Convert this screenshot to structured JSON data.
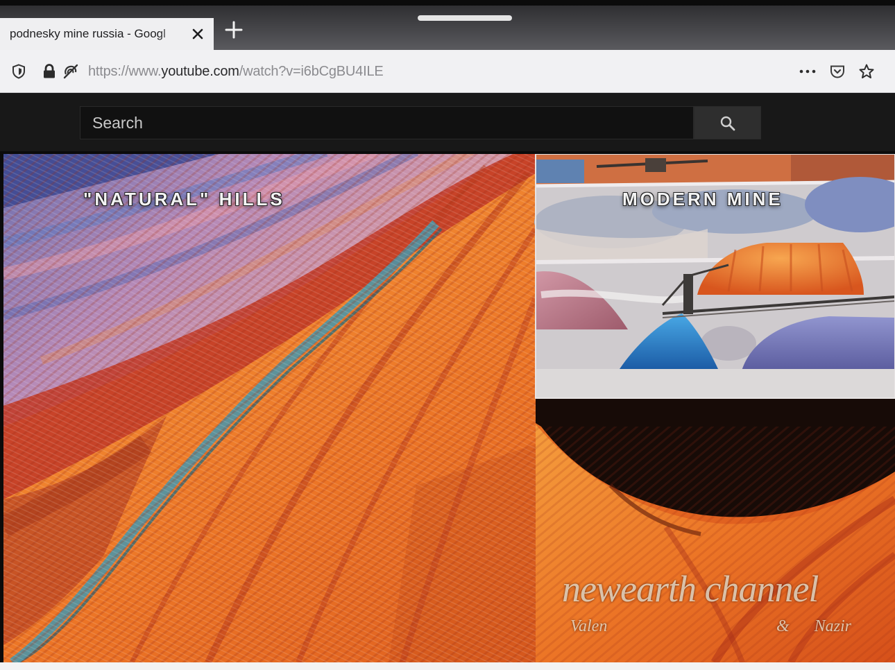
{
  "browser": {
    "tab": {
      "title": "podnesky mine russia - Googl"
    },
    "address": {
      "prefix": "https://www.",
      "domain": "youtube.com",
      "path": "/watch?v=i6bCgBU4ILE"
    },
    "icons": {
      "tab_close": "close-icon",
      "new_tab": "plus-icon",
      "tracking_protection": "shield-icon",
      "connection": "lock-icon",
      "permissions": "permissions-icon",
      "page_actions": "more-icon",
      "pocket": "pocket-icon",
      "bookmark": "star-icon"
    }
  },
  "youtube": {
    "search": {
      "placeholder": "Search"
    },
    "icons": {
      "search_button": "search-icon"
    },
    "colors": {
      "masthead": "#181818",
      "search_field": "#111111",
      "search_button": "#2e2e2e"
    }
  },
  "video": {
    "overlays": {
      "left": "\"NATURAL\" HILLS",
      "right": "MODERN MINE"
    },
    "watermark": {
      "title": "newearth channel",
      "subtitle_fragments": [
        "Valen",
        "&",
        "Nazir"
      ]
    }
  }
}
